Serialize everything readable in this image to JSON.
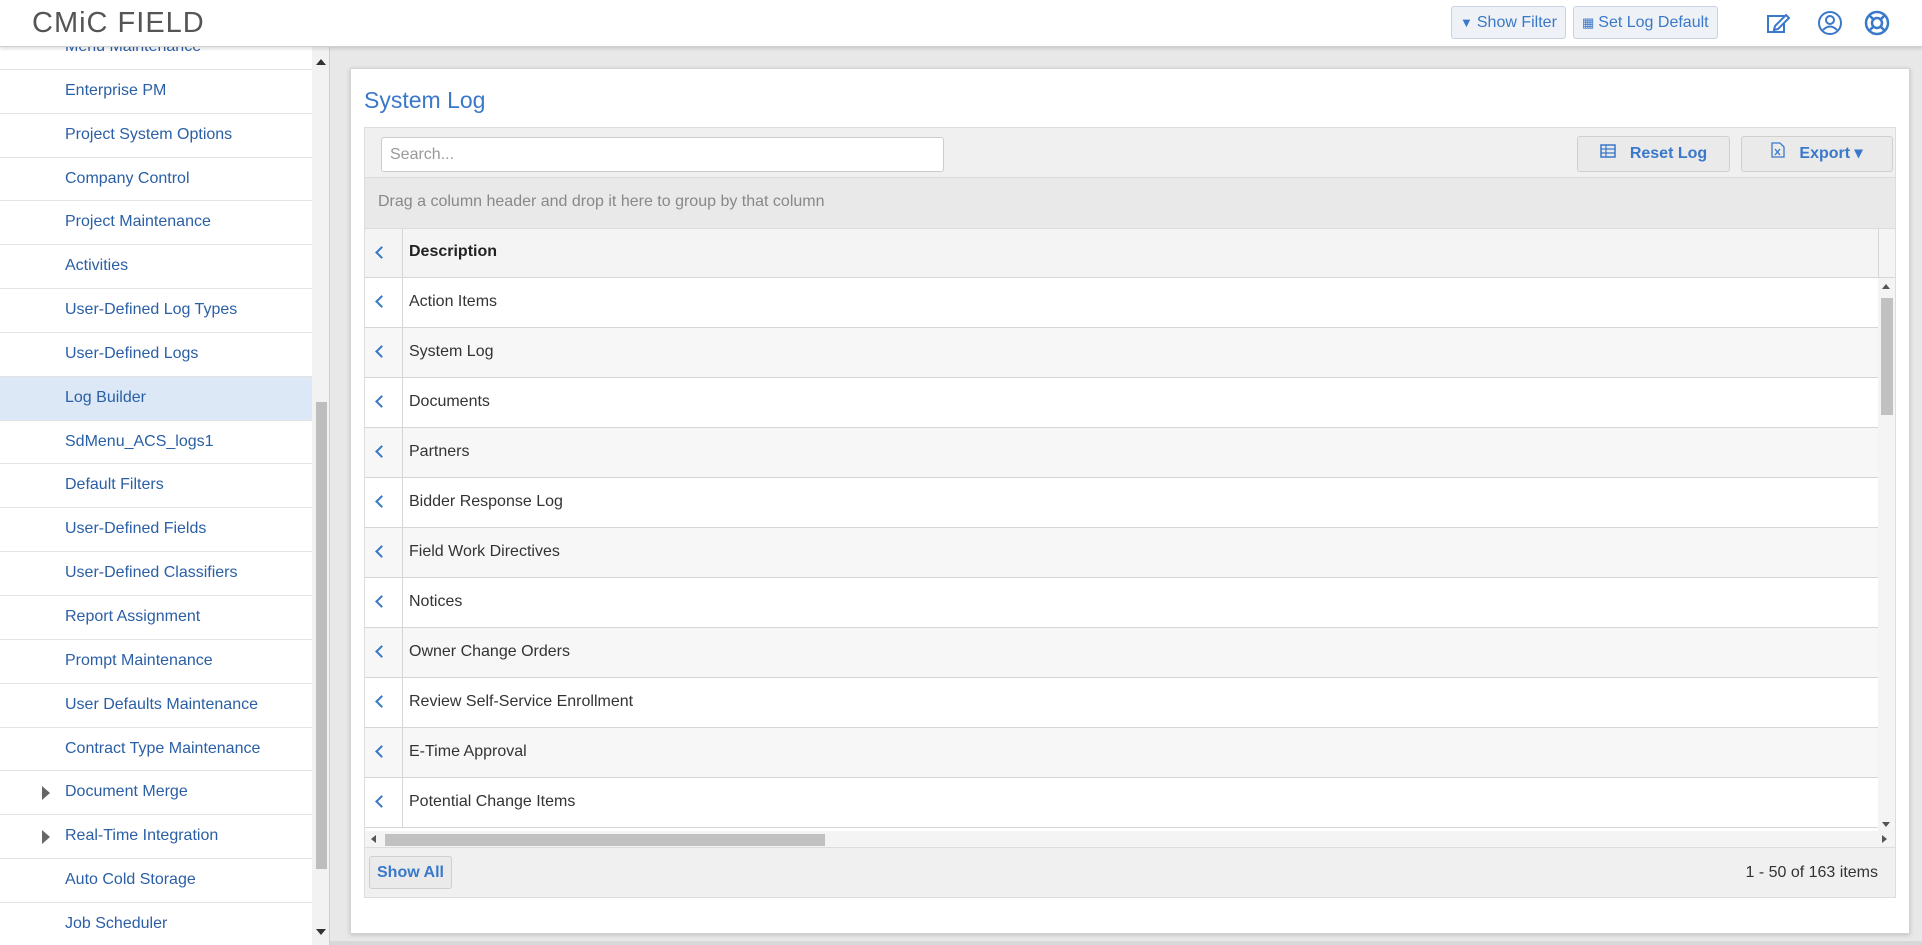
{
  "app": {
    "logo": "CMiC FIELD"
  },
  "header": {
    "show_filter_label": "Show Filter",
    "set_log_default_label": "Set Log Default",
    "icons": [
      "edit-icon",
      "user-icon",
      "help-icon"
    ]
  },
  "sidebar": {
    "items": [
      {
        "label": "Menu Maintenance",
        "expandable": false
      },
      {
        "label": "Enterprise PM",
        "expandable": false
      },
      {
        "label": "Project System Options",
        "expandable": false
      },
      {
        "label": "Company Control",
        "expandable": false
      },
      {
        "label": "Project Maintenance",
        "expandable": false
      },
      {
        "label": "Activities",
        "expandable": false
      },
      {
        "label": "User-Defined Log Types",
        "expandable": false
      },
      {
        "label": "User-Defined Logs",
        "expandable": false
      },
      {
        "label": "Log Builder",
        "expandable": false,
        "active": true
      },
      {
        "label": "SdMenu_ACS_logs1",
        "expandable": false
      },
      {
        "label": "Default Filters",
        "expandable": false
      },
      {
        "label": "User-Defined Fields",
        "expandable": false
      },
      {
        "label": "User-Defined Classifiers",
        "expandable": false
      },
      {
        "label": "Report Assignment",
        "expandable": false
      },
      {
        "label": "Prompt Maintenance",
        "expandable": false
      },
      {
        "label": "User Defaults Maintenance",
        "expandable": false
      },
      {
        "label": "Contract Type Maintenance",
        "expandable": false
      },
      {
        "label": "Document Merge",
        "expandable": true
      },
      {
        "label": "Real-Time Integration",
        "expandable": true
      },
      {
        "label": "Auto Cold Storage",
        "expandable": false
      },
      {
        "label": "Job Scheduler",
        "expandable": false
      }
    ]
  },
  "main": {
    "title": "System Log",
    "search": {
      "placeholder": "Search...",
      "value": ""
    },
    "reset_log_label": "Reset Log",
    "export_label": "Export ▾",
    "group_hint": "Drag a column header and drop it here to group by that column",
    "column_header": "Description",
    "rows": [
      "Action Items",
      "System Log",
      "Documents",
      "Partners",
      "Bidder Response Log",
      "Field Work Directives",
      "Notices",
      "Owner Change Orders",
      "Review Self-Service Enrollment",
      "E-Time Approval",
      "Potential Change Items"
    ],
    "show_all_label": "Show All",
    "pager_info": "1 - 50 of 163 items"
  },
  "colors": {
    "accent": "#3a78c9",
    "nav_text": "#2a5fa6",
    "active_row": "#dce8f5"
  }
}
